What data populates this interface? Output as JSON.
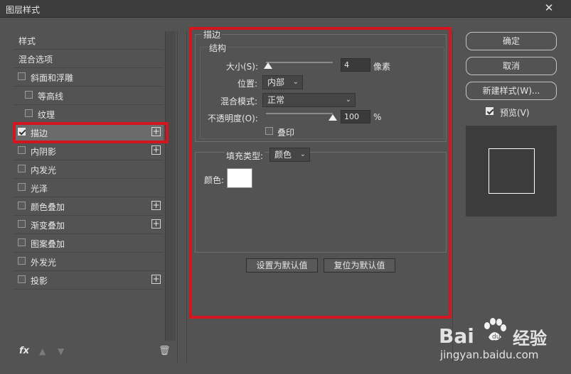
{
  "window": {
    "title": "图层样式",
    "close_glyph": "✕"
  },
  "sidebar": {
    "items": [
      {
        "label": "样式",
        "checkbox": false,
        "checked": false,
        "plus": false,
        "indent": 0
      },
      {
        "label": "混合选项",
        "checkbox": false,
        "checked": false,
        "plus": false,
        "indent": 0
      },
      {
        "label": "斜面和浮雕",
        "checkbox": true,
        "checked": false,
        "plus": false,
        "indent": 0
      },
      {
        "label": "等高线",
        "checkbox": true,
        "checked": false,
        "plus": false,
        "indent": 1
      },
      {
        "label": "纹理",
        "checkbox": true,
        "checked": false,
        "plus": false,
        "indent": 1
      },
      {
        "label": "描边",
        "checkbox": true,
        "checked": true,
        "plus": true,
        "indent": 0,
        "selected": true
      },
      {
        "label": "内阴影",
        "checkbox": true,
        "checked": false,
        "plus": true,
        "indent": 0
      },
      {
        "label": "内发光",
        "checkbox": true,
        "checked": false,
        "plus": false,
        "indent": 0
      },
      {
        "label": "光泽",
        "checkbox": true,
        "checked": false,
        "plus": false,
        "indent": 0
      },
      {
        "label": "颜色叠加",
        "checkbox": true,
        "checked": false,
        "plus": true,
        "indent": 0
      },
      {
        "label": "渐变叠加",
        "checkbox": true,
        "checked": false,
        "plus": true,
        "indent": 0
      },
      {
        "label": "图案叠加",
        "checkbox": true,
        "checked": false,
        "plus": false,
        "indent": 0
      },
      {
        "label": "外发光",
        "checkbox": true,
        "checked": false,
        "plus": false,
        "indent": 0
      },
      {
        "label": "投影",
        "checkbox": true,
        "checked": false,
        "plus": true,
        "indent": 0
      }
    ],
    "plus_glyph": "+",
    "footer": {
      "fx": "fx",
      "up_icon": "▲",
      "down_icon": "▼",
      "trash_icon": "🗑"
    }
  },
  "stroke": {
    "section_title": "描边",
    "structure_title": "结构",
    "size_label": "大小(S):",
    "size_value": "4",
    "size_unit": "像素",
    "size_fraction": 0.0,
    "position_label": "位置:",
    "position_value": "内部",
    "blend_label": "混合模式:",
    "blend_value": "正常",
    "opacity_label": "不透明度(O):",
    "opacity_value": "100",
    "opacity_unit": "%",
    "opacity_fraction": 1.0,
    "overprint_label": "叠印",
    "overprint_checked": false,
    "fill_type_label": "填充类型:",
    "fill_type_value": "颜色",
    "color_label": "颜色:",
    "color_value": "#ffffff",
    "set_default_label": "设置为默认值",
    "reset_default_label": "复位为默认值"
  },
  "actions": {
    "ok_label": "确定",
    "cancel_label": "取消",
    "new_style_label": "新建样式(W)...",
    "preview_label": "预览(V)",
    "preview_checked": true
  },
  "watermark": {
    "brand": "Bai",
    "brand2": "经验",
    "url": "jingyan.baidu.com"
  },
  "colors": {
    "highlight_red": "#d3151f",
    "panel": "#535353",
    "dark": "#3c3c3c"
  }
}
